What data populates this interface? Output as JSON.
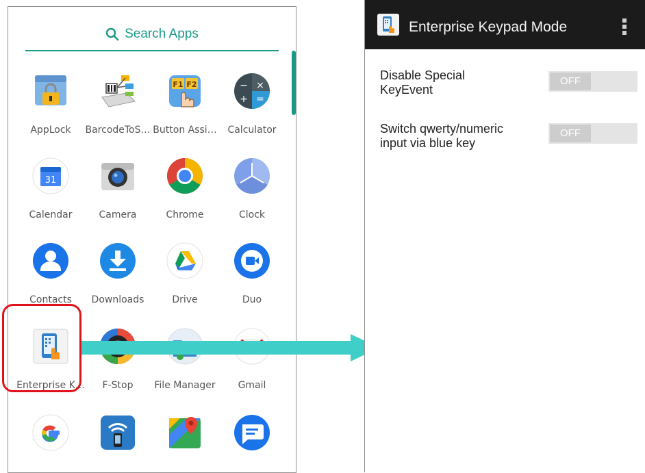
{
  "drawer": {
    "search_label": "Search Apps",
    "apps": [
      {
        "label": "AppLock",
        "icon": "applock-icon"
      },
      {
        "label": "BarcodeToS…",
        "icon": "barcode-to-settings-icon"
      },
      {
        "label": "Button Assi…",
        "icon": "button-assignment-icon"
      },
      {
        "label": "Calculator",
        "icon": "calculator-icon"
      },
      {
        "label": "Calendar",
        "icon": "calendar-icon",
        "day": "31"
      },
      {
        "label": "Camera",
        "icon": "camera-icon"
      },
      {
        "label": "Chrome",
        "icon": "chrome-icon"
      },
      {
        "label": "Clock",
        "icon": "clock-icon"
      },
      {
        "label": "Contacts",
        "icon": "contacts-icon"
      },
      {
        "label": "Downloads",
        "icon": "downloads-icon"
      },
      {
        "label": "Drive",
        "icon": "drive-icon"
      },
      {
        "label": "Duo",
        "icon": "duo-icon"
      },
      {
        "label": "Enterprise K…",
        "icon": "enterprise-keypad-icon"
      },
      {
        "label": "F-Stop",
        "icon": "fstop-icon"
      },
      {
        "label": "File Manager",
        "icon": "file-manager-icon"
      },
      {
        "label": "Gmail",
        "icon": "gmail-icon"
      },
      {
        "label": "",
        "icon": "google-icon"
      },
      {
        "label": "",
        "icon": "nfc-icon"
      },
      {
        "label": "",
        "icon": "maps-icon"
      },
      {
        "label": "",
        "icon": "messages-icon"
      }
    ],
    "calc_symbols": [
      "−",
      "×",
      "+",
      "="
    ],
    "button_assistant_keys": "F1F2"
  },
  "settings": {
    "title": "Enterprise Keypad Mode",
    "items": [
      {
        "label_line1": "Disable Special",
        "label_line2": "KeyEvent",
        "value": "OFF"
      },
      {
        "label_line1": "Switch qwerty/numeric",
        "label_line2": "input via blue key",
        "value": "OFF"
      }
    ]
  },
  "colors": {
    "accent": "#1a9988",
    "highlight": "#e0121c",
    "arrow": "#3fcfc8",
    "appbar": "#1b1b1b"
  }
}
